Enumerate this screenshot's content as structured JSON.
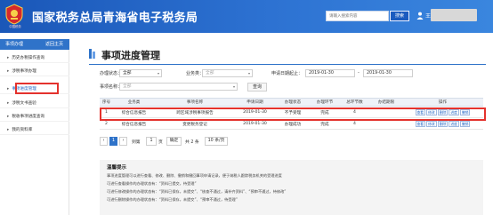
{
  "header": {
    "site_title": "国家税务总局青海省电子税务局",
    "emblem_caption": "中国税务",
    "search_placeholder": "请输入搜索内容",
    "search_label": "搜索",
    "user_prefix": "王",
    "accent": "#2d72d2"
  },
  "sidebar": {
    "head_left": "事项办理",
    "head_right": "返回主页",
    "items": [
      {
        "label": "历史办税操作查询"
      },
      {
        "label": "涉税事项办理"
      },
      {
        "label": "事项进度管理"
      },
      {
        "label": "涉税文书查验"
      },
      {
        "label": "税收事项进度查询"
      },
      {
        "label": "我的资料库"
      }
    ]
  },
  "page": {
    "title": "事项进度管理"
  },
  "filters": {
    "status_label": "办理状态：",
    "status_value": "全部",
    "category_label": "业务类：",
    "category_value": "全部",
    "date_label": "申请日期起止：",
    "date_from": "2019-01-30",
    "date_to": "2019-01-30",
    "item_name_label": "事项名称：",
    "item_name_value": "全部",
    "query_label": "查询"
  },
  "table": {
    "columns": [
      "序号",
      "业务类",
      "事项名称",
      "申请日期",
      "办理状态",
      "办理环节",
      "总环节数",
      "办结期限",
      "操作"
    ],
    "rows": [
      {
        "no": "1",
        "category": "综合信息报告",
        "name": "跨区域涉税事项报告",
        "date": "2019-01-30",
        "status": "不予受理",
        "stage": "完成",
        "total": "4",
        "deadline": ""
      },
      {
        "no": "2",
        "category": "综合信息报告",
        "name": "变更税务登记",
        "date": "2019-01-30",
        "status": "办理成功",
        "stage": "完成",
        "total": "4",
        "deadline": ""
      }
    ],
    "ops": [
      "查看",
      "修改",
      "删除",
      "进度",
      "撤销"
    ]
  },
  "pager": {
    "go_label": "到第",
    "page_input": "1",
    "page_unit": "页",
    "confirm": "确定",
    "total_text": "共 2 条",
    "page_size": "10 条/页",
    "current": "1"
  },
  "tips": {
    "title": "温馨提示",
    "lines": [
      "事项进度管理可以进行查看、修改、删除、撤销和撤回事项申请记录，便于纳税人跟踪税务机关的受理进度",
      "可进行查看操作的办理状态有：“资料已提交，待受理”",
      "可进行修改操作的办理状态有：“资料已保存，未提交”、“核查不通过，请补齐资料”、“预审不通过，待修改”",
      "可进行删除操作的办理状态有：“资料已保存，未提交”、“预审不通过，待受理”"
    ]
  }
}
